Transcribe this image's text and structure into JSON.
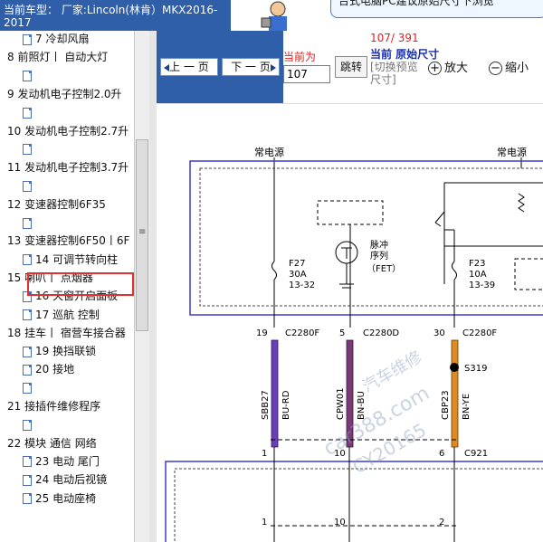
{
  "header": {
    "title_line1": "当前车型： 厂家:Lincoln(林肯）MKX2016-",
    "title_line2": "2017",
    "banner_text": "台式电脑PC建议原始尺寸下浏览"
  },
  "tree": {
    "items": [
      {
        "label": "7 冷却风扇",
        "level": 2
      },
      {
        "label": "8 前照灯丨 自动大灯",
        "level": 1
      },
      {
        "label": "",
        "level": 2
      },
      {
        "label": "9 发动机电子控制2.0升",
        "level": 1
      },
      {
        "label": "",
        "level": 2
      },
      {
        "label": "10 发动机电子控制2.7升",
        "level": 1
      },
      {
        "label": "",
        "level": 2
      },
      {
        "label": "11 发动机电子控制3.7升",
        "level": 1
      },
      {
        "label": "",
        "level": 2
      },
      {
        "label": "12 变速器控制6F35",
        "level": 1
      },
      {
        "label": "",
        "level": 2
      },
      {
        "label": "13 变速器控制6F50丨6F",
        "level": 1
      },
      {
        "label": "14 可调节转向柱",
        "level": 2
      },
      {
        "label": "15 喇叭丨 点烟器",
        "level": 1
      },
      {
        "label": "16 天窗开启面板",
        "level": 2
      },
      {
        "label": "17 巡航 控制",
        "level": 2
      },
      {
        "label": "18 挂车丨 宿营车接合器",
        "level": 1
      },
      {
        "label": "19 换挡联锁",
        "level": 2
      },
      {
        "label": "20 接地",
        "level": 2
      },
      {
        "label": "",
        "level": 2
      },
      {
        "label": "21 接插件维修程序",
        "level": 1
      },
      {
        "label": "",
        "level": 2
      },
      {
        "label": "22 模块 通信 网络",
        "level": 1
      },
      {
        "label": "23 电动 尾门",
        "level": 2
      },
      {
        "label": "24 电动后视镜",
        "level": 2
      },
      {
        "label": "25 电动座椅",
        "level": 2
      }
    ],
    "selected_index": 14
  },
  "toolbar": {
    "prev_label": "上 一 页",
    "next_label": "下 一 页",
    "current_label": "当前为",
    "page_value": "107",
    "jump_label": "跳转",
    "page_count": "107/ 391",
    "size_current": "当前 原始尺寸",
    "size_switch": "[切换预览尺寸]",
    "zoom_in_label": "放大",
    "zoom_out_label": "缩小"
  },
  "diagram": {
    "power_label_1": "常电源",
    "power_label_2": "常电源",
    "fuse1_name": "F27",
    "fuse1_rating": "30A",
    "fuse1_loc": "13-32",
    "fet_label_1": "脉冲",
    "fet_label_2": "序列",
    "fet_label_3": "（FET）",
    "fuse2_name": "F23",
    "fuse2_rating": "10A",
    "fuse2_loc": "13-39",
    "pin_19": "19",
    "conn_c2280f_a": "C2280F",
    "pin_5": "5",
    "conn_c2280d": "C2280D",
    "pin_30": "30",
    "conn_c2280f_b": "C2280F",
    "splice": "S319",
    "wire1_code": "SBB27",
    "wire1_color": "BU-RD",
    "wire2_code": "CPW01",
    "wire2_color": "BN-BU",
    "wire3_code": "CBP23",
    "wire3_color": "BN-YE",
    "pin_1": "1",
    "pin_10": "10",
    "pin_6": "6",
    "conn_c921": "C921",
    "pin_1b": "1",
    "pin_10b": "10",
    "pin_2b": "2",
    "watermark_1": "汽车维修",
    "watermark_2": "car388.com",
    "watermark_3": "CY20165"
  },
  "colors": {
    "toolbar_blue": "#2e5fa8",
    "highlight_red": "#e03030",
    "wire_purple": "#6a3fb5",
    "wire_brown_blue": "#7a3a7a",
    "wire_orange": "#e08a20",
    "box_blue": "#3c3cd0"
  }
}
